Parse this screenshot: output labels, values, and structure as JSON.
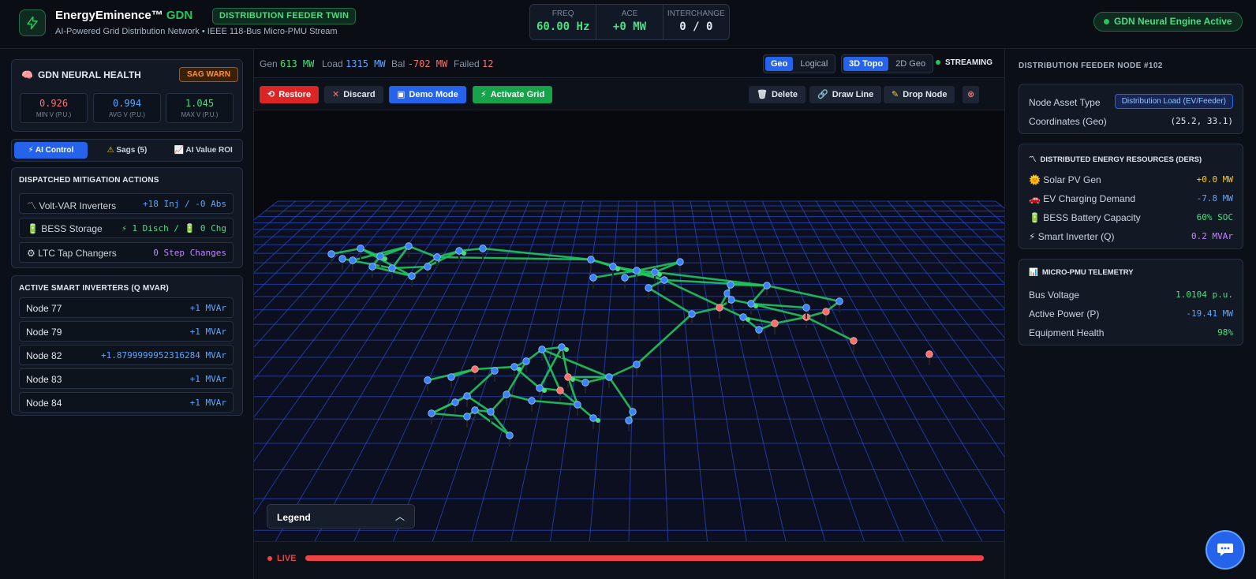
{
  "header": {
    "brand_name": "EnergyEminence™",
    "brand_suffix": "GDN",
    "badge": "DISTRIBUTION FEEDER TWIN",
    "subtitle": "AI-Powered Grid Distribution Network • IEEE 118-Bus Micro-PMU Stream",
    "kpis": [
      {
        "label": "FREQ",
        "value": "60.00 Hz",
        "color": "#4ade80"
      },
      {
        "label": "ACE",
        "value": "+0 MW",
        "color": "#4ade80"
      },
      {
        "label": "INTERCHANGE",
        "value": "0 / 0",
        "color": "#e2e8f0"
      }
    ],
    "engine_status": "GDN Neural Engine Active"
  },
  "health": {
    "title": "GDN NEURAL HEALTH",
    "badge": "SAG WARN",
    "boxes": [
      {
        "value": "0.926",
        "label": "MIN V (P.U.)",
        "color": "#f87171"
      },
      {
        "value": "0.994",
        "label": "AVG V (P.U.)",
        "color": "#60a5fa"
      },
      {
        "value": "1.045",
        "label": "MAX V (P.U.)",
        "color": "#4ade80"
      }
    ]
  },
  "left_tabs": [
    {
      "label": "AI Control",
      "icon": "⚡",
      "active": true
    },
    {
      "label": "Sags (5)",
      "icon": "⚠",
      "active": false
    },
    {
      "label": "AI Value ROI",
      "icon": "📈",
      "active": false
    }
  ],
  "mitigation": {
    "title": "DISPATCHED MITIGATION ACTIONS",
    "rows": [
      {
        "icon": "〽",
        "name": "Volt-VAR Inverters",
        "value": "+18 Inj / -0 Abs",
        "color": "#60a5fa"
      },
      {
        "icon": "🔋",
        "name": "BESS Storage",
        "value": "⚡ 1 Disch / 🔋 0 Chg",
        "color": "#4ade80"
      },
      {
        "icon": "⚙",
        "name": "LTC Tap Changers",
        "value": "0 Step Changes",
        "color": "#c084fc"
      }
    ]
  },
  "inverters": {
    "title": "ACTIVE SMART INVERTERS (Q MVAR)",
    "rows": [
      {
        "name": "Node 77",
        "value": "+1 MVAr"
      },
      {
        "name": "Node 79",
        "value": "+1 MVAr"
      },
      {
        "name": "Node 82",
        "value": "+1.8799999952316284 MVAr"
      },
      {
        "name": "Node 83",
        "value": "+1 MVAr"
      },
      {
        "name": "Node 84",
        "value": "+1 MVAr"
      }
    ]
  },
  "statbar": {
    "gen_label": "Gen",
    "gen_value": "613 MW",
    "load_label": "Load",
    "load_value": "1315 MW",
    "bal_label": "Bal",
    "bal_value": "-702 MW",
    "failed_label": "Failed",
    "failed_value": "12",
    "view_modes": [
      "Geo",
      "Logical"
    ],
    "topo_modes": [
      "3D Topo",
      "2D Geo"
    ],
    "stream": "STREAMING"
  },
  "toolbar": {
    "restore": "Restore",
    "discard": "Discard",
    "demo": "Demo Mode",
    "activate": "Activate Grid",
    "delete": "Delete",
    "draw_line": "Draw Line",
    "drop_node": "Drop Node"
  },
  "legend": {
    "label": "Legend"
  },
  "live": {
    "label": "LIVE",
    "progress": 1.0
  },
  "node": {
    "title": "DISTRIBUTION FEEDER NODE #102",
    "asset_type_label": "Node Asset Type",
    "asset_type_value": "Distribution Load (EV/Feeder)",
    "coords_label": "Coordinates (Geo)",
    "coords_value": "(25.2, 33.1)"
  },
  "ders": {
    "title": "DISTRIBUTED ENERGY RESOURCES (DERS)",
    "rows": [
      {
        "icon": "🌞",
        "name": "Solar PV Gen",
        "value": "+0.0 MW",
        "color": "#facc15"
      },
      {
        "icon": "🚗",
        "name": "EV Charging Demand",
        "value": "-7.8 MW",
        "color": "#60a5fa"
      },
      {
        "icon": "🔋",
        "name": "BESS Battery Capacity",
        "value": "60% SOC",
        "color": "#4ade80"
      },
      {
        "icon": "⚡",
        "name": "Smart Inverter (Q)",
        "value": "0.2 MVAr",
        "color": "#c084fc"
      }
    ]
  },
  "pmu": {
    "title": "MICRO-PMU TELEMETRY",
    "rows": [
      {
        "name": "Bus Voltage",
        "value": "1.0104 p.u.",
        "color": "#4ade80"
      },
      {
        "name": "Active Power (P)",
        "value": "-19.41 MW",
        "color": "#60a5fa"
      },
      {
        "name": "Equipment Health",
        "value": "98%",
        "color": "#4ade80"
      }
    ]
  },
  "colors": {
    "accent": "#2563eb",
    "ok": "#22c55e",
    "fault": "#ef4444",
    "node": "#3b82f6"
  }
}
